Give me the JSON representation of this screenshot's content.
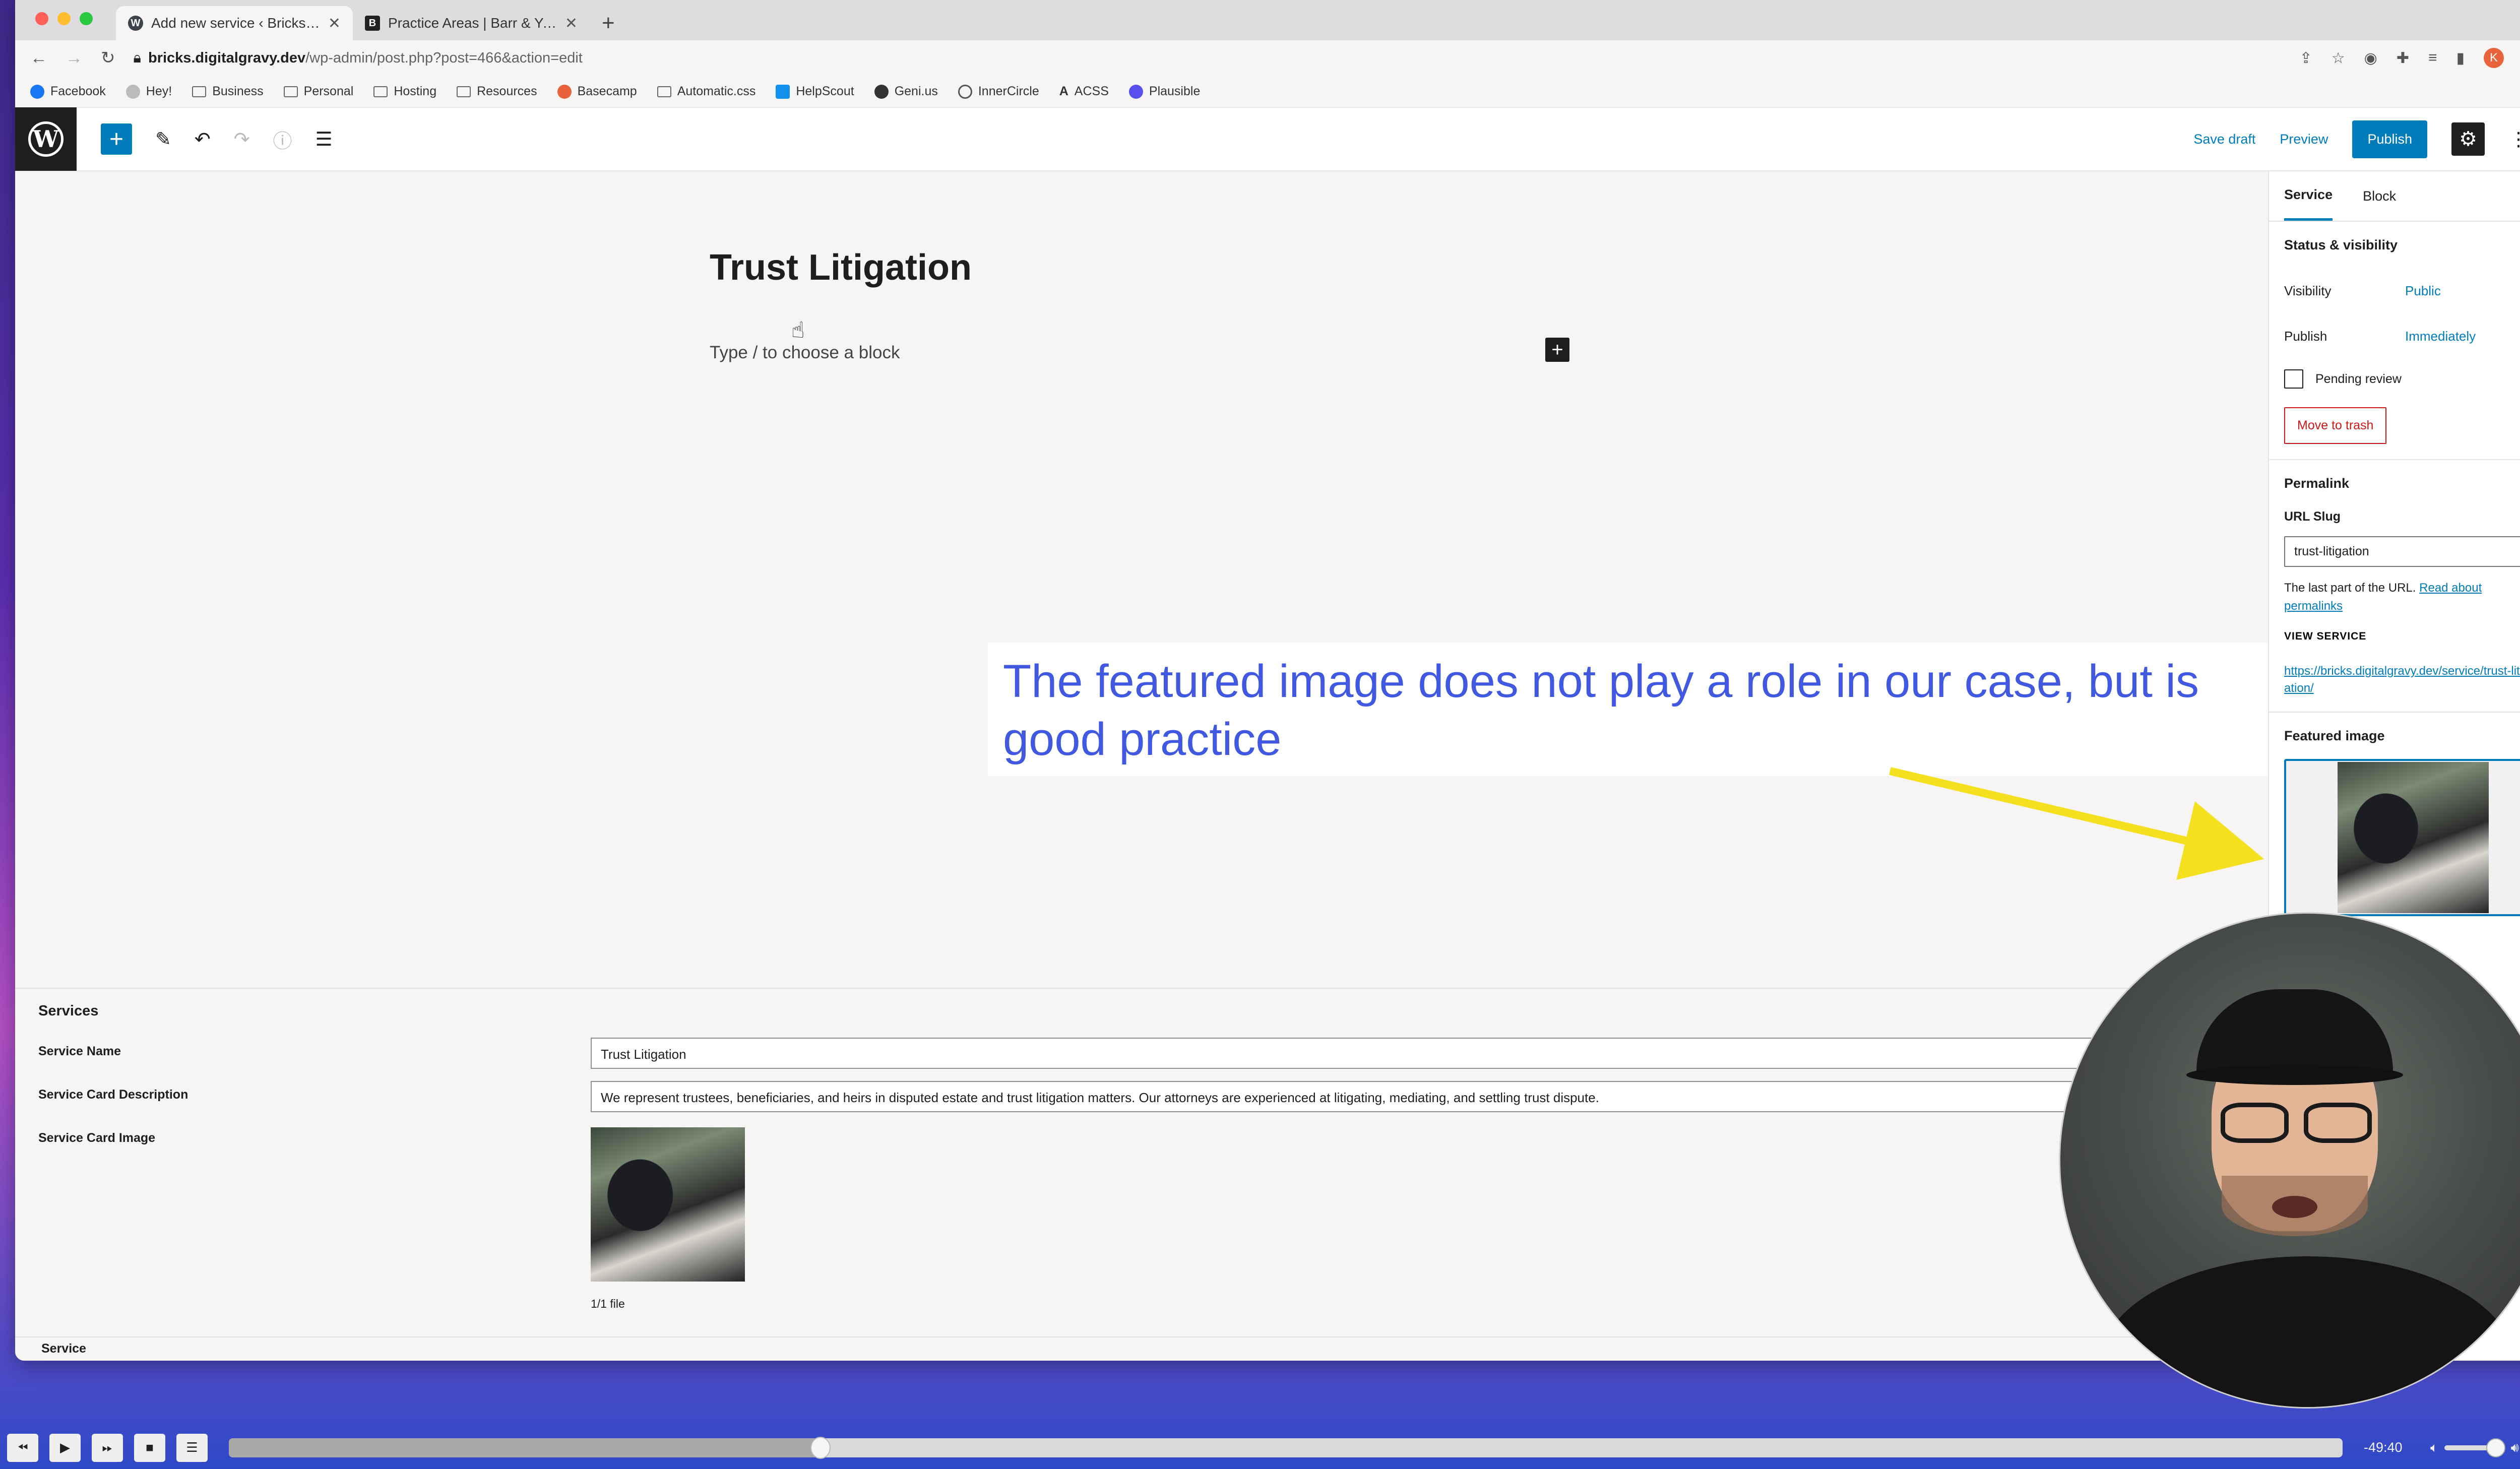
{
  "browser": {
    "tabs": [
      {
        "title": "Add new service ‹ Bricks — W",
        "icon": "wordpress-favicon",
        "active": true
      },
      {
        "title": "Practice Areas | Barr & Young A",
        "icon": "site-favicon",
        "active": false
      }
    ],
    "url_host": "bricks.digitalgravy.dev",
    "url_path": "/wp-admin/post.php?post=466&action=edit",
    "avatar_initial": "K",
    "bookmarks": [
      {
        "label": "Facebook",
        "icon": "facebook-icon",
        "color": "#1877f2"
      },
      {
        "label": "Hey!",
        "icon": "hey-icon",
        "color": "#999999"
      },
      {
        "label": "Business",
        "icon": "folder-icon"
      },
      {
        "label": "Personal",
        "icon": "folder-icon"
      },
      {
        "label": "Hosting",
        "icon": "folder-icon"
      },
      {
        "label": "Resources",
        "icon": "folder-icon"
      },
      {
        "label": "Basecamp",
        "icon": "basecamp-icon",
        "color": "#e8623c"
      },
      {
        "label": "Automatic.css",
        "icon": "folder-icon"
      },
      {
        "label": "HelpScout",
        "icon": "helpscout-icon",
        "color": "#1292ee"
      },
      {
        "label": "Geni.us",
        "icon": "globe-icon",
        "color": "#333333"
      },
      {
        "label": "InnerCircle",
        "icon": "circle-icon",
        "color": "#555555"
      },
      {
        "label": "ACSS",
        "icon": "acss-icon",
        "color": "#333333"
      },
      {
        "label": "Plausible",
        "icon": "plausible-icon",
        "color": "#5850ec"
      }
    ]
  },
  "toolbar": {
    "save_draft": "Save draft",
    "preview": "Preview",
    "publish": "Publish"
  },
  "editor": {
    "title": "Trust Litigation",
    "placeholder": "Type / to choose a block"
  },
  "annotation": {
    "text": "The featured image does not play a role in our case, but is good practice",
    "color": "#4059e0",
    "arrow_color": "#f5e020"
  },
  "sidebar": {
    "tabs": [
      "Service",
      "Block"
    ],
    "status": {
      "heading": "Status & visibility",
      "visibility_label": "Visibility",
      "visibility_value": "Public",
      "publish_label": "Publish",
      "publish_value": "Immediately",
      "pending_label": "Pending review",
      "trash": "Move to trash"
    },
    "permalink": {
      "heading": "Permalink",
      "slug_label": "URL Slug",
      "slug_value": "trust-litigation",
      "help_text": "The last part of the URL.",
      "help_link": "Read about permalinks",
      "view_label": "VIEW SERVICE",
      "view_url": "https://bricks.digitalgravy.dev/service/trust-litigation/"
    },
    "featured_image": {
      "heading": "Featured image"
    }
  },
  "metabox": {
    "title": "Services",
    "service_name_label": "Service Name",
    "service_name_value": "Trust Litigation",
    "description_label": "Service Card Description",
    "description_value": "We represent trustees, beneficiaries, and heirs in disputed estate and trust litigation matters. Our attorneys are experienced at litigating, mediating, and settling trust dispute.",
    "image_label": "Service Card Image",
    "file_count": "1/1 file",
    "footer_label": "Service"
  },
  "player": {
    "time_remaining": "-49:40",
    "progress_fraction": 0.28,
    "volume_fraction": 0.85
  }
}
